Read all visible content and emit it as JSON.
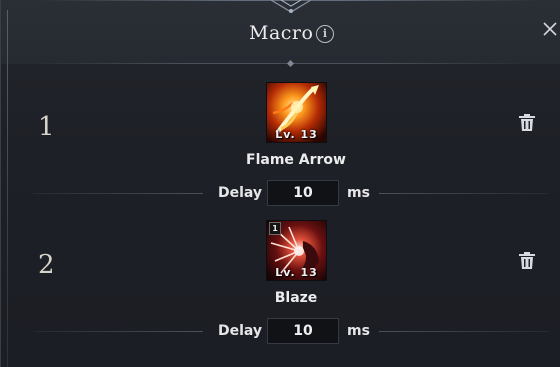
{
  "dialog": {
    "title": "Macro",
    "info_icon_glyph": "i",
    "info_icon": "info-icon",
    "close_icon": "close-icon"
  },
  "entries": [
    {
      "number": "1",
      "skill_name": "Flame Arrow",
      "skill_level": "Lv. 13",
      "skill_badge": "",
      "delay_label": "Delay",
      "delay_value": "10",
      "delay_unit": "ms",
      "delete_icon": "trash-icon"
    },
    {
      "number": "2",
      "skill_name": "Blaze",
      "skill_level": "Lv. 13",
      "skill_badge": "1",
      "delay_label": "Delay",
      "delay_value": "10",
      "delay_unit": "ms",
      "delete_icon": "trash-icon"
    }
  ],
  "colors": {
    "background": "#1f2228",
    "header": "#262a31",
    "text": "#ececee",
    "input_bg": "#101216"
  }
}
